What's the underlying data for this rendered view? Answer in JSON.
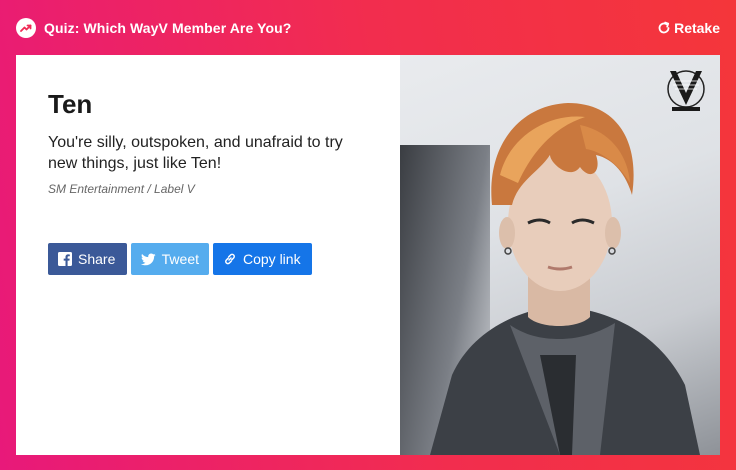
{
  "header": {
    "title": "Quiz: Which WayV Member Are You?",
    "retake_label": "Retake"
  },
  "result": {
    "name": "Ten",
    "description": "You're silly, outspoken, and unafraid to try new things, just like Ten!",
    "source": "SM Entertainment / Label V"
  },
  "share": {
    "facebook_label": "Share",
    "twitter_label": "Tweet",
    "copy_label": "Copy link"
  },
  "colors": {
    "facebook": "#3b5998",
    "twitter": "#55acee",
    "copy": "#1575e8",
    "gradient_start": "#e8197a",
    "gradient_end": "#f4363a"
  },
  "icons": {
    "quiz": "trending-up-icon",
    "retake": "refresh-icon",
    "facebook": "facebook-icon",
    "twitter": "twitter-icon",
    "copy": "link-icon"
  }
}
